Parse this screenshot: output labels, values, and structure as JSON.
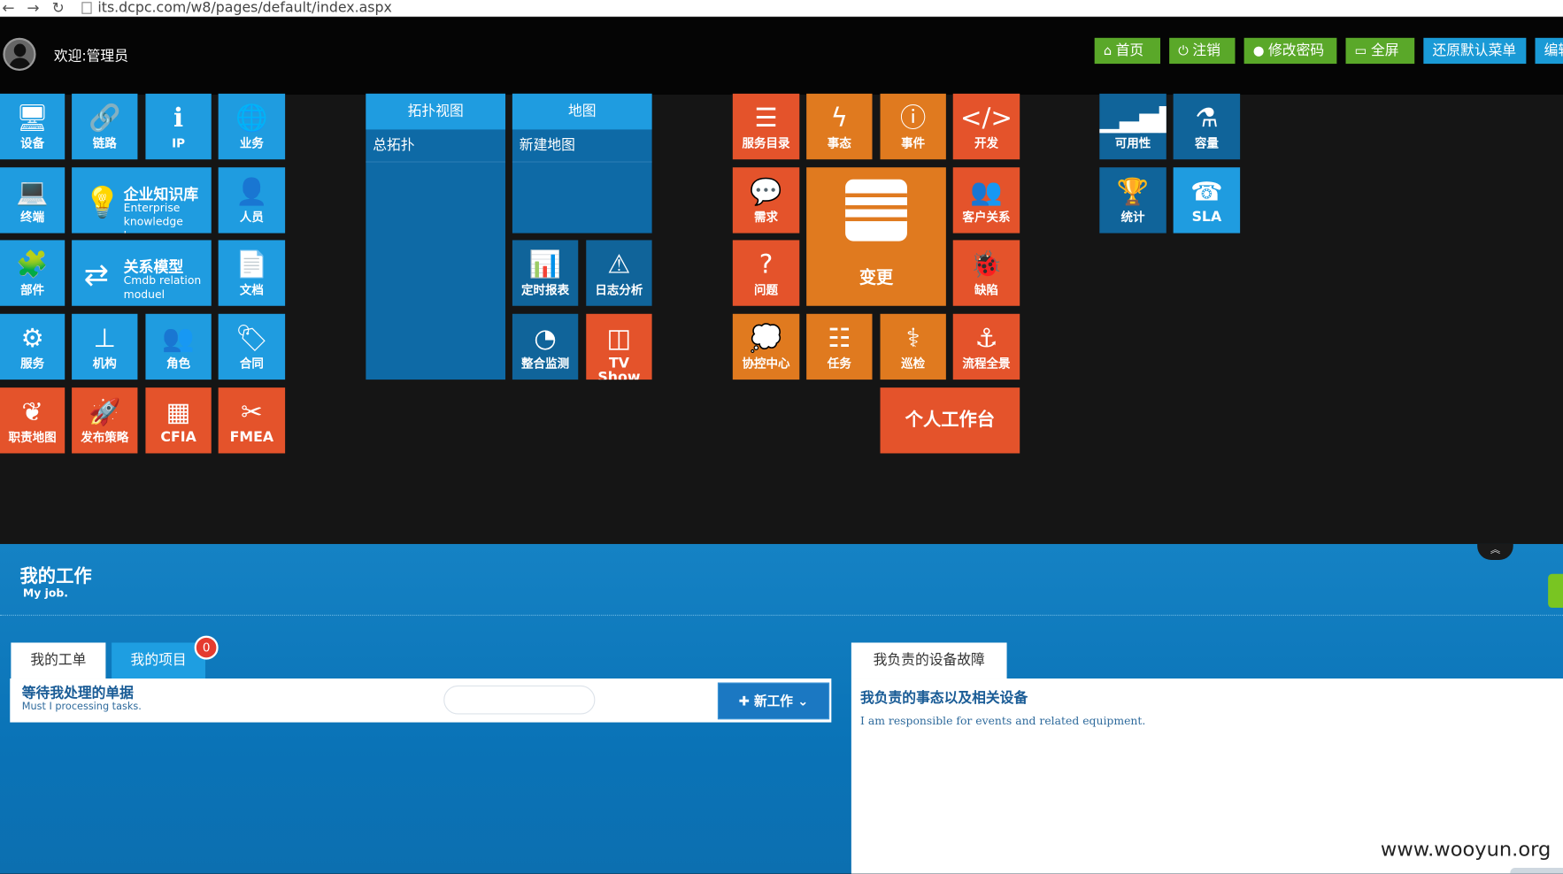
{
  "browser": {
    "url": "its.dcpc.com/w8/pages/default/index.aspx"
  },
  "header": {
    "welcome": "欢迎:管理员",
    "buttons": {
      "home": "首页",
      "logout": "注销",
      "change_password": "修改密码",
      "fullscreen": "全屏",
      "restore_menu": "还原默认菜单",
      "edit": "编辑"
    }
  },
  "tiles": {
    "device": "设备",
    "link": "链路",
    "ip": "IP",
    "business": "业务",
    "terminal": "终端",
    "knowledge_title": "企业知识库",
    "knowledge_sub": "Enterprise knowledge base",
    "personnel": "人员",
    "component": "部件",
    "relation_title": "关系模型",
    "relation_sub": "Cmdb relation moduel",
    "document": "文档",
    "service": "服务",
    "organization": "机构",
    "role": "角色",
    "contract": "合同",
    "duty_map": "职责地图",
    "release_strategy": "发布策略",
    "cfia": "CFIA",
    "fmea": "FMEA",
    "topology_header": "拓扑视图",
    "topology_item": "总拓扑",
    "map_header": "地图",
    "map_item": "新建地图",
    "scheduled_report": "定时报表",
    "log_analysis": "日志分析",
    "integrated_monitor": "整合监测",
    "tv_show": "TV Show",
    "service_catalog": "服务目录",
    "situation": "事态",
    "event": "事件",
    "develop": "开发",
    "demand": "需求",
    "change": "变更",
    "customer_relation": "客户关系",
    "problem": "问题",
    "defect": "缺陷",
    "coordination_center": "协控中心",
    "task": "任务",
    "inspection": "巡检",
    "process_panorama": "流程全景",
    "personal_workbench": "个人工作台",
    "availability": "可用性",
    "capacity": "容量",
    "statistics": "统计",
    "sla": "SLA"
  },
  "work": {
    "title": "我的工作",
    "subtitle": "My job.",
    "tabs": {
      "my_orders": "我的工单",
      "my_projects": "我的项目",
      "my_device_faults": "我负责的设备故障"
    },
    "project_badge": "0",
    "pending_title": "等待我处理的单据",
    "pending_sub": "Must I processing tasks.",
    "search_placeholder": "",
    "new_work": "新工作",
    "events_title": "我负责的事态以及相关设备",
    "events_sub": "I am responsible for events and related equipment."
  },
  "watermark": "www.wooyun.org",
  "colors": {
    "tile_blue": "#1f9ce0",
    "tile_red": "#e4532b",
    "tile_orange": "#e07a1f",
    "tile_dark": "#10649a",
    "header_green": "#5aa829",
    "header_blue": "#1a9ad6"
  }
}
